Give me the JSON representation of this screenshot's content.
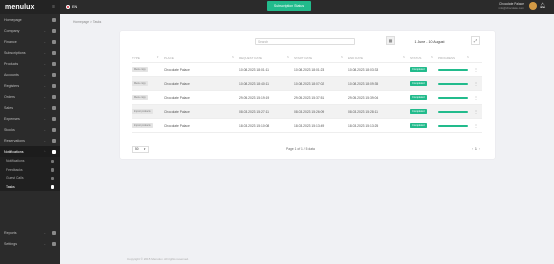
{
  "brand": {
    "logo": "menulux"
  },
  "sidebar": {
    "items": [
      {
        "label": "Homepage",
        "icon": "home-icon"
      },
      {
        "label": "Company",
        "icon": "building-icon"
      },
      {
        "label": "Finance",
        "icon": "finance-icon"
      },
      {
        "label": "Subscriptions",
        "icon": "subscription-icon"
      },
      {
        "label": "Products",
        "icon": "box-icon"
      },
      {
        "label": "Accounts",
        "icon": "user-icon"
      },
      {
        "label": "Registers",
        "icon": "register-icon"
      },
      {
        "label": "Orders",
        "icon": "orders-icon"
      },
      {
        "label": "Sales",
        "icon": "sales-icon"
      },
      {
        "label": "Expenses",
        "icon": "expenses-icon"
      },
      {
        "label": "Stocks",
        "icon": "stocks-icon"
      },
      {
        "label": "Reservations",
        "icon": "calendar-icon"
      },
      {
        "label": "Notifications",
        "icon": "notification-icon"
      }
    ],
    "sub_items": [
      {
        "label": "Notifications",
        "icon": "bell-icon"
      },
      {
        "label": "Feedbacks",
        "icon": "feedback-icon"
      },
      {
        "label": "Guest Calls",
        "icon": "phone-icon"
      },
      {
        "label": "Tasks",
        "icon": "tasks-icon"
      }
    ],
    "bottom_items": [
      {
        "label": "Reports",
        "icon": "reports-icon"
      },
      {
        "label": "Settings",
        "icon": "settings-icon"
      }
    ]
  },
  "topbar": {
    "lang": "EN",
    "subscription_button": "Subscription Status",
    "user_name": "Chocolate Palace",
    "user_email": "info@chocolate.com"
  },
  "breadcrumb": "Homepage > Tasks",
  "toolbar": {
    "search_placeholder": "Search",
    "date_range": "1 June - 10 August"
  },
  "table": {
    "columns": [
      "TYPE",
      "PLACE",
      "REQUEST DATE",
      "START DATE",
      "END DATE",
      "STATUS",
      "PROGRESS",
      ""
    ],
    "rows": [
      {
        "type": "Menu copy",
        "place": "Chocolate Palace",
        "request": "10.08.2023 18:01:11",
        "start": "10.08.2023 18:01:23",
        "end": "10.08.2023 18:03:33",
        "status": "Completed",
        "progress": 100
      },
      {
        "type": "Menu copy",
        "place": "Chocolate Palace",
        "request": "10.08.2023 18:40:11",
        "start": "10.08.2023 18:07:02",
        "end": "10.08.2023 18:09:35",
        "status": "Completed",
        "progress": 100
      },
      {
        "type": "Menu copy",
        "place": "Chocolate Palace",
        "request": "29.05.2023 15:19:19",
        "start": "29.05.2023 15:37:51",
        "end": "29.05.2023 15:39:04",
        "status": "Completed",
        "progress": 100
      },
      {
        "type": "Import products",
        "place": "Chocolate Palace",
        "request": "08.03.2023 15:27:11",
        "start": "08.03.2023 15:26:09",
        "end": "08.03.2023 15:28:11",
        "status": "Completed",
        "progress": 100
      },
      {
        "type": "Import products",
        "place": "Chocolate Palace",
        "request": "18.03.2023 15:10:08",
        "start": "18.03.2023 15:13:49",
        "end": "18.03.2023 15:13:25",
        "status": "Completed",
        "progress": 100
      }
    ]
  },
  "pagination": {
    "per_page": "50",
    "info": "Page 1 of 1 / 5 data",
    "prev": "‹",
    "current": "1",
    "next": "›"
  },
  "footer": "Copyright © 2015 Menulux. All rights reserved.",
  "colors": {
    "accent": "#22bb8c",
    "sidebar": "#2b2b2b",
    "topbar": "#2b2b2b"
  }
}
